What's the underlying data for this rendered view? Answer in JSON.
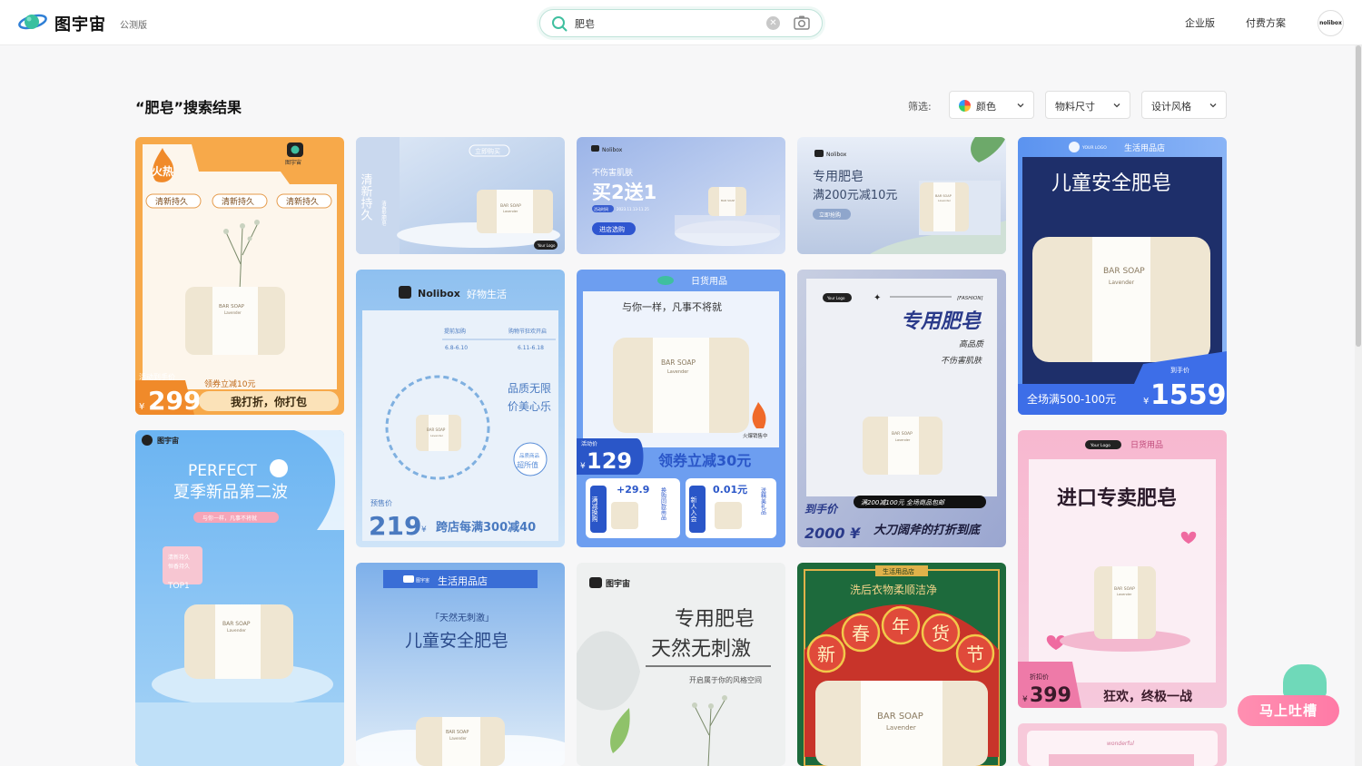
{
  "header": {
    "logo_text": "图宇宙",
    "beta_badge": "公测版",
    "search_value": "肥皂",
    "nav": [
      "企业版",
      "付费方案"
    ],
    "avatar_text": "nolibox"
  },
  "results": {
    "title": "“肥皂”搜索结果",
    "filter_label": "筛选:",
    "filters": [
      "颜色",
      "物料尺寸",
      "设计风格"
    ]
  },
  "cards": {
    "c1": {
      "flame": "火热",
      "tags": [
        "清新持久",
        "清新持久",
        "清新持久"
      ],
      "soap": "BAR SOAP",
      "soap_sub": "Lavender",
      "price_label": "活动到手价",
      "price": "299",
      "coupon": "领券立减10元",
      "slogan": "我打折，你打包",
      "currency": "¥",
      "brand": "图宇宙"
    },
    "c2": {
      "vertical": "清新持久",
      "sub": "清香型肥皂",
      "tag": "立即购买",
      "soap": "BAR SOAP",
      "soap_sub": "Lavender",
      "logo": "Your Logo"
    },
    "c3": {
      "brand": "Nolibox",
      "line1": "不伤害肌肤",
      "big": "买2送1",
      "date_label": "活动时间",
      "date": "2023.11.13-11.25",
      "btn": "进店选购",
      "soap": "BAR SOAP"
    },
    "c4": {
      "brand": "Nolibox",
      "line1": "专用肥皂",
      "line2": "满200元减10元",
      "btn": "立即抢购",
      "soap": "BAR SOAP",
      "soap_sub": "Lavender"
    },
    "c5": {
      "logo": "YOUR LOGO",
      "store": "生活用品店",
      "title": "儿童安全肥皂",
      "soap": "BAR SOAP",
      "soap_sub": "Lavender",
      "promo": "全场满500-100元",
      "price_label": "到手价",
      "currency": "¥",
      "price": "1559"
    },
    "c6": {
      "brand": "Nolibox",
      "tagline": "好物生活",
      "t1": "提前加购",
      "d1": "6.8-6.10",
      "t2": "购物节狂欢开启",
      "d2": "6.11-6.18",
      "s1": "品质无限",
      "s2": "价美心乐",
      "badge1": "品质商品",
      "badge2": "超所值",
      "price_label": "预售价",
      "price": "219",
      "currency": "¥",
      "promo": "跨店每满300减40",
      "soap": "BAR SOAP",
      "soap_sub": "Lavender"
    },
    "c7": {
      "store": "日货用品",
      "headline": "与你一样，凡事不将就",
      "soap": "BAR SOAP",
      "soap_sub": "Lavender",
      "hot": "火爆销售中",
      "act": "活动价",
      "currency": "¥",
      "price": "129",
      "coupon": "领券立减30元",
      "p1": "+29.9",
      "v1": "换购同款商品",
      "l1": "满减换购",
      "p2": "0.01元",
      "v2": "送精美礼品",
      "l2": "新人入会"
    },
    "c8": {
      "logo": "Your Logo",
      "fashion": "[FASHION]",
      "title": "专用肥皂",
      "sub1": "高品质",
      "sub2": "不伤害肌肤",
      "soap": "BAR SOAP",
      "soap_sub": "Lavender",
      "price_label": "到手价",
      "price": "2000 ¥",
      "promo": "满200减100元 全场商品包邮",
      "slogan": "大刀阔斧的打折到底"
    },
    "c9": {
      "brand": "图宇宙",
      "line1": "PERFECT",
      "line2": "夏季新品第二波",
      "sub": "与你一样，凡事不将就",
      "tag1": "清新持久",
      "tag2": "恒香持久",
      "top": "TOP1",
      "soap": "BAR SOAP",
      "soap_sub": "Lavender"
    },
    "c10": {
      "brand": "图宇宙",
      "store": "生活用品店",
      "quote": "「天然无刺激」",
      "title": "儿童安全肥皂",
      "soap": "BAR SOAP",
      "soap_sub": "Lavender"
    },
    "c11": {
      "brand": "图宇宙",
      "l1": "专用肥皂",
      "l2": "天然无刺激",
      "sub": "开启属于你的风格空间"
    },
    "c12": {
      "store": "生活用品店",
      "line": "洗后衣物柔顺洁净",
      "chars": [
        "新",
        "春",
        "年",
        "货",
        "节"
      ],
      "soap": "BAR SOAP",
      "soap_sub": "Lavender"
    },
    "c13": {
      "logo": "Your Logo",
      "store": "日货用品",
      "title": "进口专卖肥皂",
      "soap": "BAR SOAP",
      "soap_sub": "Lavender",
      "price_label": "折扣价",
      "currency": "¥",
      "price": "399",
      "slogan": "狂欢，终极一战"
    },
    "c14": {
      "top": "wonderful"
    }
  },
  "feedback": {
    "label": "马上吐槽"
  },
  "colors": {
    "accent": "#3fbf9f",
    "orange": "#f7a94a",
    "blue": "#3a7be0",
    "red_green": "#1a6a3a"
  },
  "icons": [
    "search-icon",
    "clear-icon",
    "camera-icon",
    "chevron-down-icon",
    "color-wheel-icon",
    "flame-icon",
    "leaf-icon",
    "heart-icon"
  ]
}
